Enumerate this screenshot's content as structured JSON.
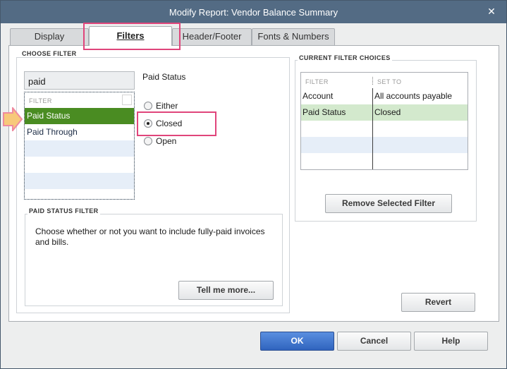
{
  "window": {
    "title": "Modify Report: Vendor Balance Summary",
    "close_glyph": "✕"
  },
  "tabs": [
    {
      "label": "Display"
    },
    {
      "label": "Filters"
    },
    {
      "label": "Header/Footer"
    },
    {
      "label": "Fonts & Numbers"
    }
  ],
  "choose_filter": {
    "section_label": "CHOOSE FILTER",
    "search_value": "paid",
    "list_header": "FILTER",
    "items": [
      {
        "label": "Paid Status"
      },
      {
        "label": "Paid Through"
      }
    ],
    "selected_item": "Paid Status"
  },
  "paid_status": {
    "title": "Paid Status",
    "options": [
      {
        "label": "Either"
      },
      {
        "label": "Closed"
      },
      {
        "label": "Open"
      }
    ],
    "selected": "Closed"
  },
  "status_filter": {
    "section_label": "PAID STATUS FILTER",
    "description": "Choose whether or not you want to include fully-paid invoices and bills.",
    "tell_me_more_label": "Tell me more..."
  },
  "current_filters": {
    "section_label": "CURRENT FILTER CHOICES",
    "col_filter": "FILTER",
    "col_set_to": "SET TO",
    "rows": [
      {
        "filter": "Account",
        "set_to": "All accounts payable"
      },
      {
        "filter": "Paid Status",
        "set_to": "Closed"
      }
    ],
    "remove_label": "Remove Selected Filter"
  },
  "buttons": {
    "revert": "Revert",
    "ok": "OK",
    "cancel": "Cancel",
    "help": "Help"
  },
  "colors": {
    "titlebar": "#536b84",
    "selected_row": "#4a8c22",
    "selected_current_row": "#d3e9cd",
    "highlight_box": "#e0457b",
    "pointer_arrow": "#f7c97a",
    "ok_button": "#3064be"
  },
  "icons": {
    "pointer": "arrow-right-icon",
    "close": "close-icon"
  }
}
